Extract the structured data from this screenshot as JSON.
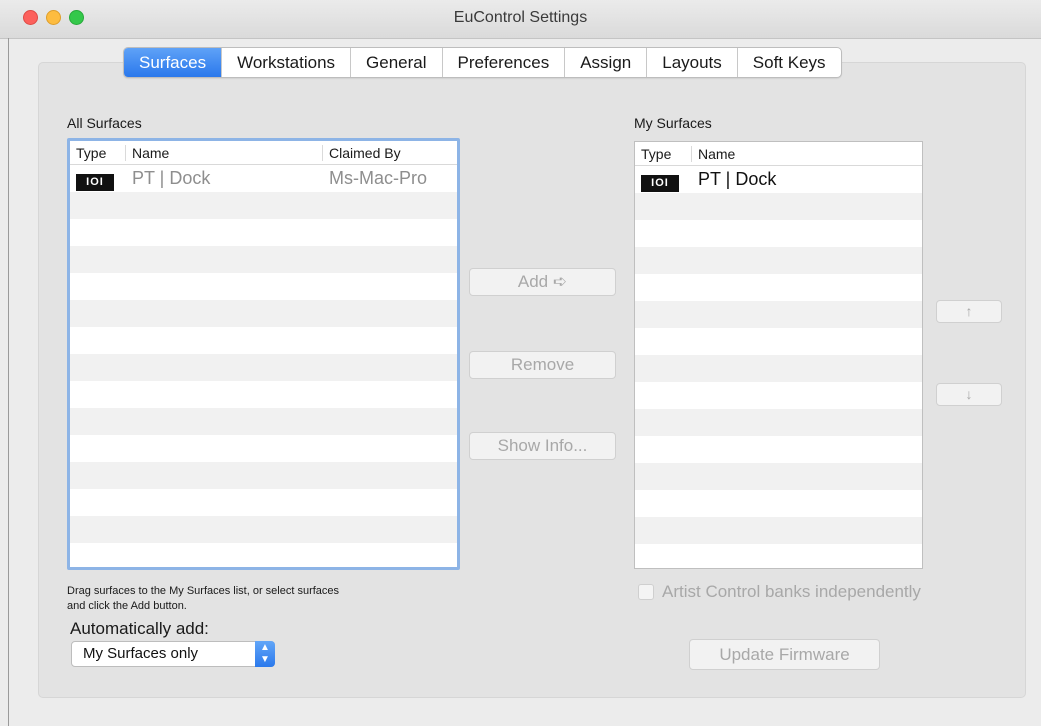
{
  "window": {
    "title": "EuControl Settings"
  },
  "tabs": [
    {
      "label": "Surfaces",
      "active": true
    },
    {
      "label": "Workstations"
    },
    {
      "label": "General"
    },
    {
      "label": "Preferences"
    },
    {
      "label": "Assign"
    },
    {
      "label": "Layouts"
    },
    {
      "label": "Soft Keys"
    }
  ],
  "all_surfaces": {
    "label": "All Surfaces",
    "columns": [
      "Type",
      "Name",
      "Claimed By"
    ],
    "rows": [
      {
        "type_icon": "IOI",
        "name": "PT | Dock",
        "claimed_by": "Ms-Mac-Pro"
      }
    ]
  },
  "my_surfaces": {
    "label": "My Surfaces",
    "columns": [
      "Type",
      "Name"
    ],
    "rows": [
      {
        "type_icon": "IOI",
        "name": "PT | Dock"
      }
    ]
  },
  "buttons": {
    "add": "Add ➪",
    "remove": "Remove",
    "show_info": "Show Info...",
    "move_up": "↑",
    "move_down": "↓",
    "update_firmware": "Update Firmware"
  },
  "hint": {
    "line1": "Drag surfaces to the My Surfaces list, or select surfaces",
    "line2": "and click the Add button."
  },
  "auto_add": {
    "label": "Automatically add:",
    "selected": "My Surfaces only"
  },
  "artist_control": {
    "label": "Artist Control banks independently",
    "checked": false,
    "enabled": false
  },
  "colors": {
    "accent": "#2a78ec",
    "list_focus_border": "#8db4e6",
    "disabled_text": "#a8a8a8"
  }
}
